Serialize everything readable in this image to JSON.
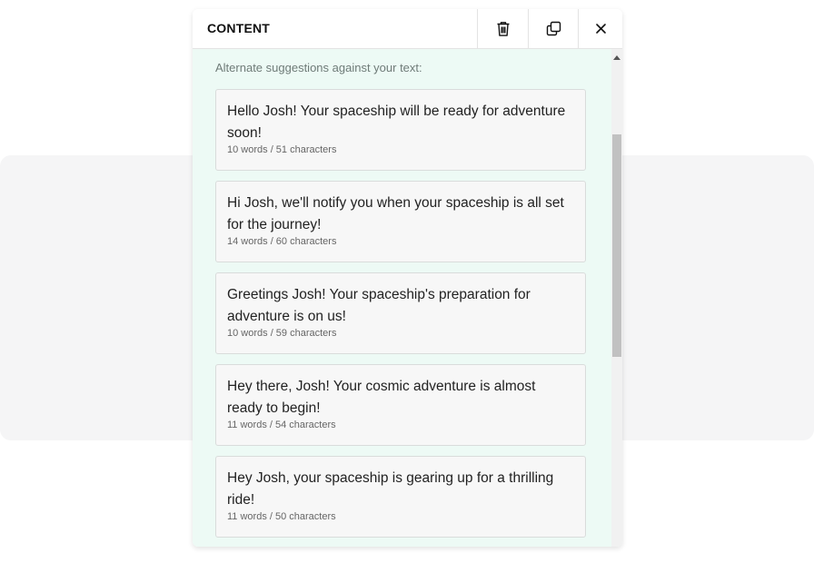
{
  "panel": {
    "title": "CONTENT"
  },
  "header_actions": {
    "delete_icon": "trash-icon",
    "copy_icon": "copy-icon",
    "close_icon": "close-icon"
  },
  "intro_text": "Alternate suggestions against your text:",
  "suggestions": [
    {
      "text": "Hello Josh! Your spaceship will be ready for adventure soon!",
      "meta": "10 words / 51 characters"
    },
    {
      "text": "Hi Josh, we'll notify you when your spaceship is all set for the journey!",
      "meta": "14 words / 60 characters"
    },
    {
      "text": "Greetings Josh! Your spaceship's preparation for adventure is on us!",
      "meta": "10 words / 59 characters"
    },
    {
      "text": "Hey there, Josh! Your cosmic adventure is almost ready to begin!",
      "meta": "11 words / 54 characters"
    },
    {
      "text": "Hey Josh, your spaceship is gearing up for a thrilling ride!",
      "meta": "11 words / 50 characters"
    }
  ],
  "colors": {
    "panel_body": "#edfaf5",
    "card_bg": "#f7f7f7",
    "card_border": "#d9dcdb",
    "background_card": "#f5f5f6"
  }
}
